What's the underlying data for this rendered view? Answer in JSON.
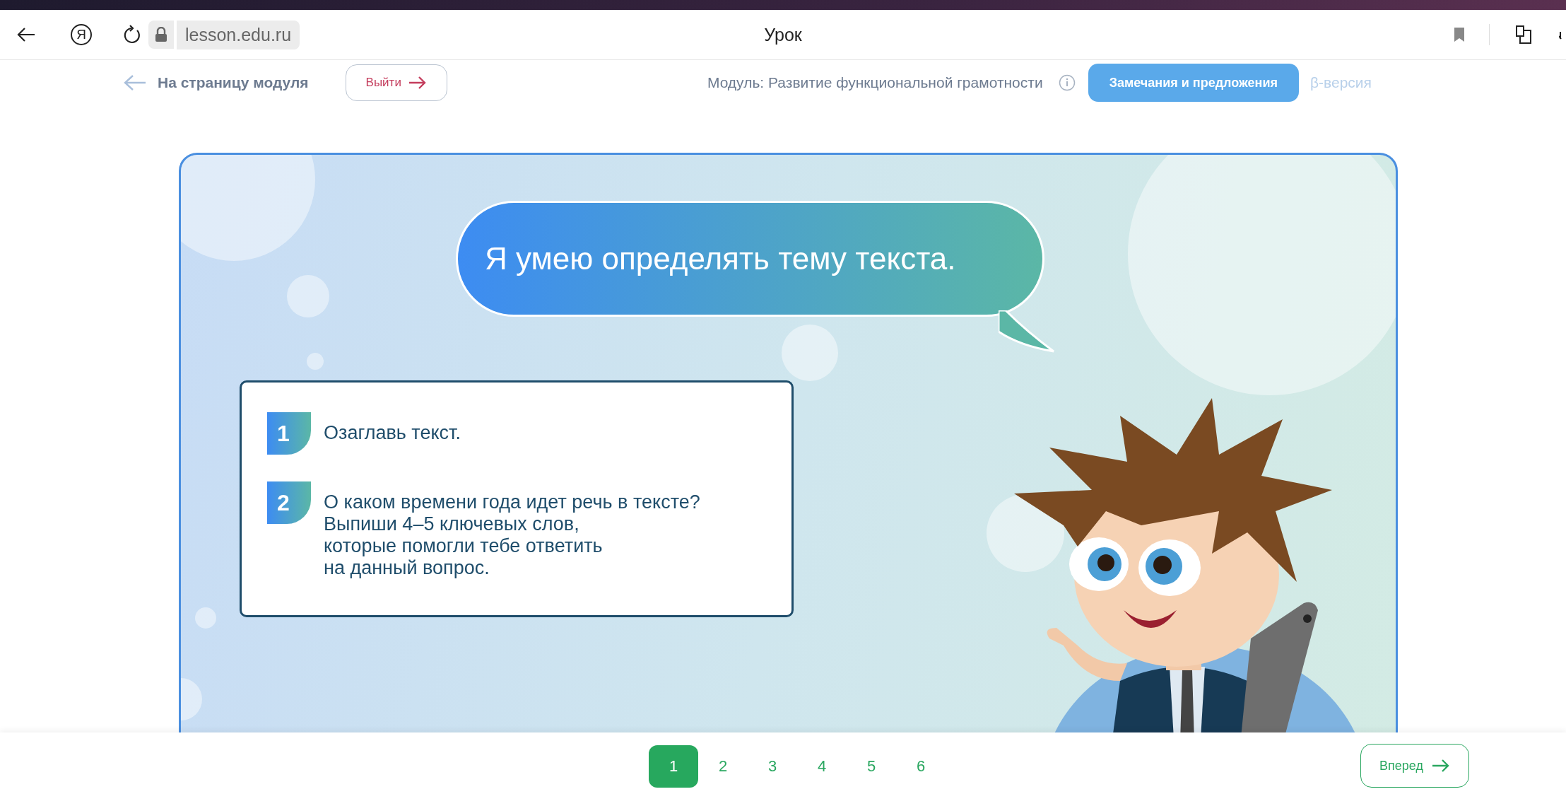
{
  "browser": {
    "logo": "Я",
    "url": "lesson.edu.ru",
    "title": "Урок"
  },
  "nav": {
    "back_link": "На страницу модуля",
    "exit_button": "Выйти",
    "module": "Модуль: Развитие функциональной грамотности",
    "feedback_button": "Замечания и предложения",
    "version": "β-версия"
  },
  "lesson": {
    "bubble": "Я умею определять тему текста.",
    "tasks": [
      {
        "number": "1",
        "text": "Озаглавь текст."
      },
      {
        "number": "2",
        "text": "О каком времени года идет речь в тексте?\nВыпиши 4–5 ключевых слов,\nкоторые помогли тебе ответить\nна данный вопрос."
      }
    ]
  },
  "pagination": {
    "pages": [
      {
        "label": "1",
        "selected": true
      },
      {
        "label": "2",
        "selected": false
      },
      {
        "label": "3",
        "selected": false
      },
      {
        "label": "4",
        "selected": false
      },
      {
        "label": "5",
        "selected": false
      },
      {
        "label": "6",
        "selected": false
      }
    ]
  },
  "next_button": "Вперед"
}
